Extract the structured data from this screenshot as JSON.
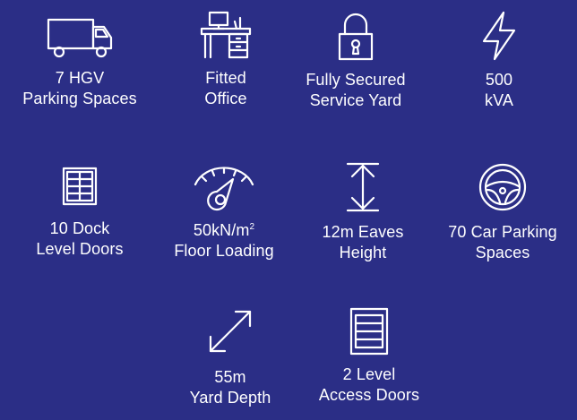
{
  "features": [
    {
      "icon": "truck-icon",
      "line1": "7 HGV",
      "line2": "Parking Spaces"
    },
    {
      "icon": "desk-icon",
      "line1": "Fitted",
      "line2": "Office"
    },
    {
      "icon": "padlock-icon",
      "line1": "Fully Secured",
      "line2": "Service Yard"
    },
    {
      "icon": "lightning-bolt-icon",
      "line1": "500",
      "line2": "kVA"
    },
    {
      "icon": "dock-door-icon",
      "line1": "10 Dock",
      "line2": "Level Doors"
    },
    {
      "icon": "gauge-weight-icon",
      "line1_main": "50kN/m",
      "line1_sup": "2",
      "line2": "Floor Loading"
    },
    {
      "icon": "vertical-height-arrow-icon",
      "line1": "12m Eaves",
      "line2": "Height"
    },
    {
      "icon": "steering-wheel-icon",
      "line1": "70 Car Parking",
      "line2": "Spaces"
    },
    {
      "icon": "diagonal-arrow-icon",
      "line1": "55m",
      "line2": "Yard Depth"
    },
    {
      "icon": "roller-door-icon",
      "line1": "2 Level",
      "line2": "Access Doors"
    }
  ],
  "colors": {
    "background": "#2b2e86",
    "foreground": "#ffffff"
  }
}
